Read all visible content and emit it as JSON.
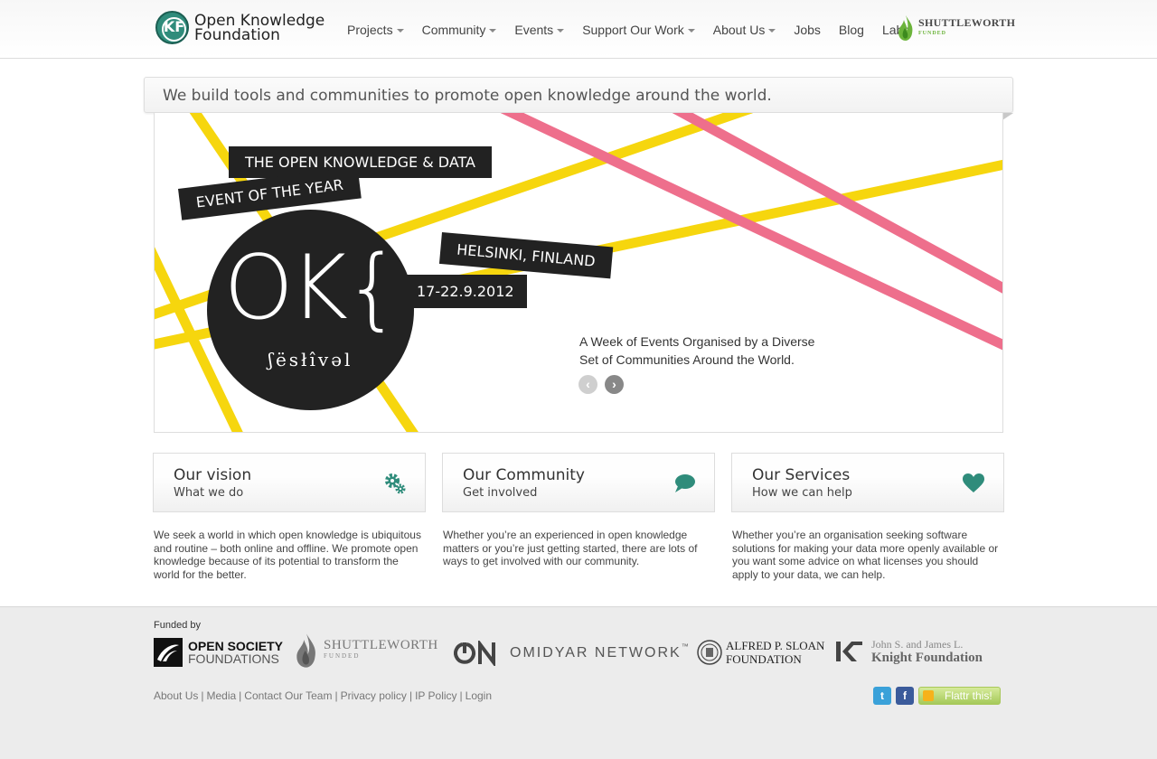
{
  "header": {
    "logo_mark": "KF",
    "logo_line1": "Open Knowledge",
    "logo_line2": "Foundation",
    "nav": [
      {
        "label": "Projects",
        "dropdown": true
      },
      {
        "label": "Community",
        "dropdown": true
      },
      {
        "label": "Events",
        "dropdown": true
      },
      {
        "label": "Support Our Work",
        "dropdown": true
      },
      {
        "label": "About Us",
        "dropdown": true
      },
      {
        "label": "Jobs",
        "dropdown": false
      },
      {
        "label": "Blog",
        "dropdown": false
      },
      {
        "label": "Labs",
        "dropdown": false
      }
    ],
    "funded_badge": {
      "name": "SHUTTLEWORTH",
      "sub": "FUNDED",
      "accent": "#6bb33a"
    }
  },
  "tagline": "We build tools and communities to promote open knowledge around the world.",
  "slide": {
    "badge1": "THE OPEN KNOWLEDGE & DATA",
    "badge2": "EVENT OF THE YEAR",
    "badge3": "HELSINKI, FINLAND",
    "badge4": "17-22.9.2012",
    "circle_logo": "OK{",
    "circle_sub": "ʃësłîvəl",
    "caption_line1": "A Week of Events Organised by a Diverse",
    "caption_line2": "Set of Communities Around the World.",
    "prev_glyph": "‹",
    "next_glyph": "›",
    "colors": {
      "yellow": "#f6d60e",
      "pink": "#ee6f8c",
      "dark": "#222222"
    }
  },
  "boxes": [
    {
      "title": "Our vision",
      "subtitle": "What we do",
      "icon": "gears-icon",
      "text": "We seek a world in which open knowledge is ubiquitous and routine – both online and offline. We promote open knowledge because of its potential to transform the world for the better."
    },
    {
      "title": "Our Community",
      "subtitle": "Get involved",
      "icon": "speech-bubble-icon",
      "text": "Whether you’re an experienced in open knowledge matters or you’re just getting started, there are lots of ways to get involved with our community."
    },
    {
      "title": "Our Services",
      "subtitle": "How we can help",
      "icon": "heart-icon",
      "text": "Whether you’re an organisation seeking software solutions for making your data more openly available or you want some advice on what licenses you should apply to your data, we can help."
    }
  ],
  "accent_color": "#2f8c7b",
  "footer": {
    "funded_by": "Funded by",
    "funders": [
      {
        "line1": "OPEN SOCIETY",
        "line2": "FOUNDATIONS"
      },
      {
        "line1": "SHUTTLEWORTH",
        "line2": "FUNDED"
      },
      {
        "line1": "OMIDYAR NETWORK",
        "line2": "™"
      },
      {
        "line1": "ALFRED P. SLOAN",
        "line2": "FOUNDATION"
      },
      {
        "line1": "John S. and James L.",
        "line2": "Knight Foundation"
      }
    ],
    "links": [
      "About Us",
      "Media",
      "Contact Our Team",
      "Privacy policy",
      "IP Policy",
      "Login"
    ],
    "social": {
      "twitter": "t",
      "facebook": "f"
    },
    "flattr": "Flattr this!"
  }
}
